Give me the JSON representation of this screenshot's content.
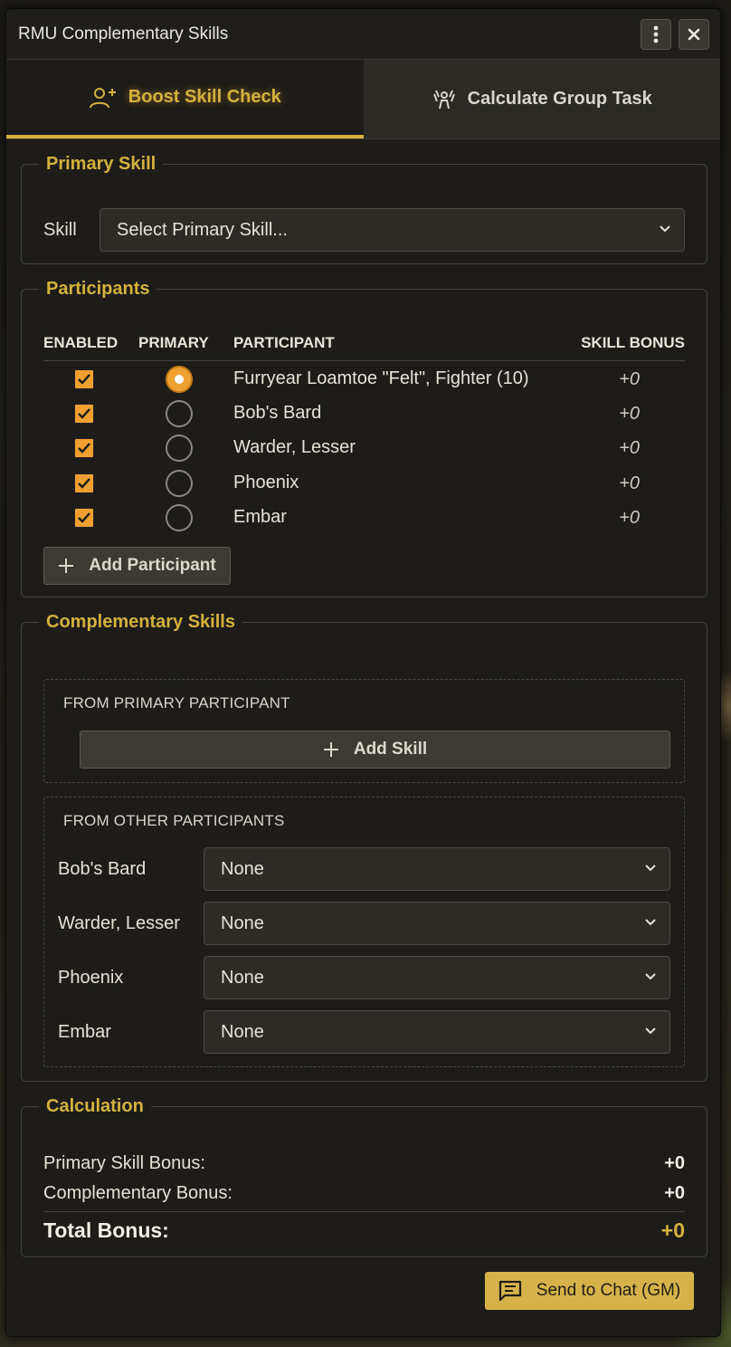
{
  "window": {
    "title": "RMU Complementary Skills",
    "menu_icon": "kebab-menu-icon",
    "close_icon": "close-icon"
  },
  "tabs": [
    {
      "label": "Boost Skill Check",
      "icon": "user-plus-icon",
      "active": true
    },
    {
      "label": "Calculate Group Task",
      "icon": "group-cheer-icon",
      "active": false
    }
  ],
  "primary_skill": {
    "legend": "Primary Skill",
    "skill_label": "Skill",
    "skill_value": "Select Primary Skill..."
  },
  "participants": {
    "legend": "Participants",
    "headers": {
      "enabled": "ENABLED",
      "primary": "PRIMARY",
      "participant": "PARTICIPANT",
      "skill_bonus": "SKILL BONUS"
    },
    "rows": [
      {
        "name": "Furryear Loamtoe \"Felt\", Fighter (10)",
        "bonus": "+0",
        "enabled": true,
        "primary": true
      },
      {
        "name": "Bob's Bard",
        "bonus": "+0",
        "enabled": true,
        "primary": false
      },
      {
        "name": "Warder, Lesser",
        "bonus": "+0",
        "enabled": true,
        "primary": false
      },
      {
        "name": "Phoenix",
        "bonus": "+0",
        "enabled": true,
        "primary": false
      },
      {
        "name": "Embar",
        "bonus": "+0",
        "enabled": true,
        "primary": false
      }
    ],
    "add_label": "Add Participant"
  },
  "complementary": {
    "legend": "Complementary Skills",
    "from_primary_header": "FROM PRIMARY PARTICIPANT",
    "add_skill_label": "Add Skill",
    "from_other_header": "FROM OTHER PARTICIPANTS",
    "others": [
      {
        "name": "Bob's Bard",
        "value": "None"
      },
      {
        "name": "Warder, Lesser",
        "value": "None"
      },
      {
        "name": "Phoenix",
        "value": "None"
      },
      {
        "name": "Embar",
        "value": "None"
      }
    ]
  },
  "calculation": {
    "legend": "Calculation",
    "primary_label": "Primary Skill Bonus:",
    "primary_value": "+0",
    "complementary_label": "Complementary Bonus:",
    "complementary_value": "+0",
    "total_label": "Total Bonus:",
    "total_value": "+0"
  },
  "send_button": {
    "label": "Send to Chat (GM)",
    "icon": "chat-message-icon"
  },
  "colors": {
    "accent": "#d4b13e",
    "checkbox": "#f0a030",
    "panel": "#1d1c19"
  }
}
